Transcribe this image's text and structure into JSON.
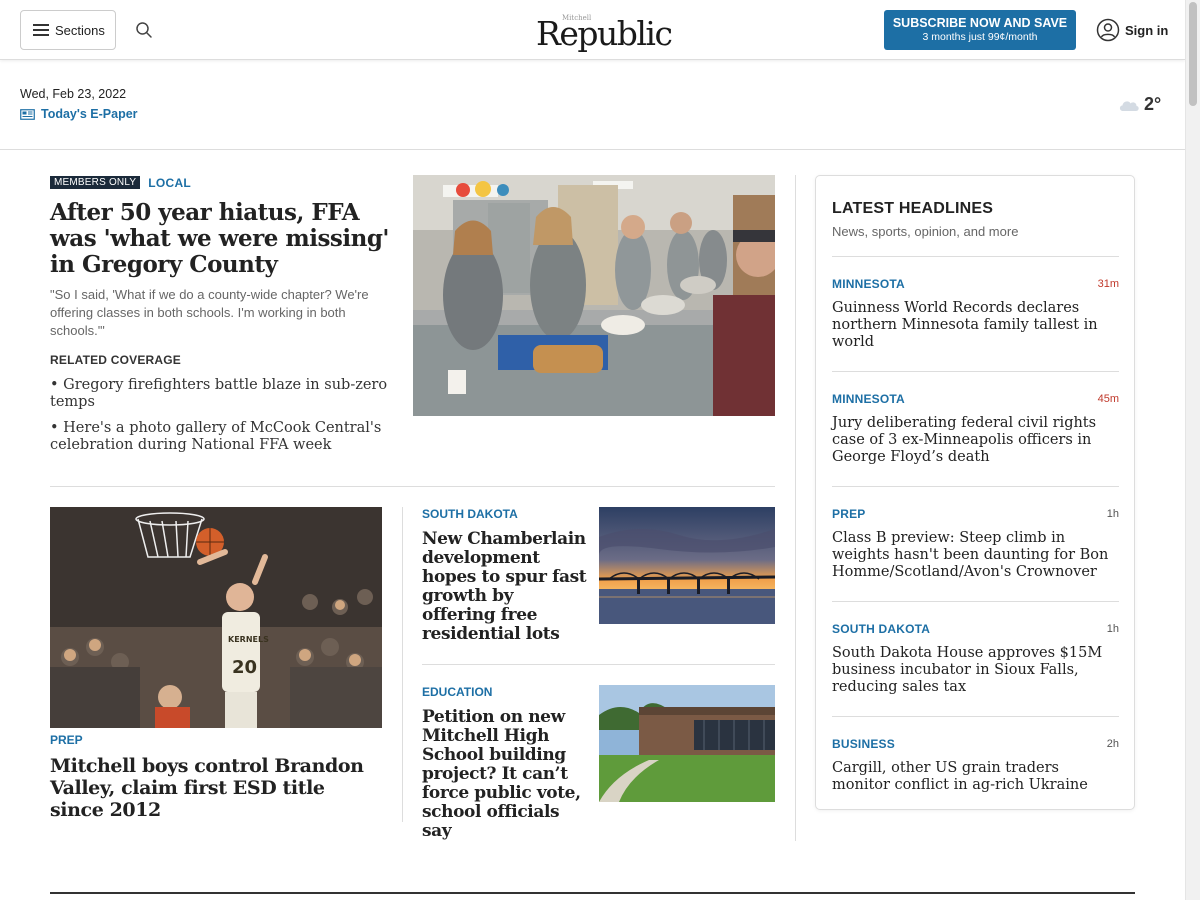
{
  "header": {
    "sections_label": "Sections",
    "logo_small": "Mitchell",
    "logo_main": "Republic",
    "subscribe_main": "SUBSCRIBE NOW AND SAVE",
    "subscribe_sub": "3 months just 99¢/month",
    "signin_label": "Sign in"
  },
  "datebar": {
    "date": "Wed, Feb 23, 2022",
    "epaper_label": "Today's E-Paper",
    "temperature": "2°"
  },
  "lead": {
    "badge": "MEMBERS ONLY",
    "kicker": "LOCAL",
    "title": "After 50 year hiatus, FFA was 'what we were missing' in Gregory County",
    "summary": "\"So I said, 'What if we do a county-wide chapter? We're offering classes in both schools. I'm working in both schools.'\"",
    "related_label": "RELATED COVERAGE",
    "related": [
      "• Gregory firefighters battle blaze in sub-zero temps",
      "• Here's a photo gallery of McCook Central's celebration during National FFA week"
    ]
  },
  "stories": {
    "basketball": {
      "kicker": "PREP",
      "title": "Mitchell boys control Brandon Valley, claim first ESD title since 2012",
      "jersey_text": "KERNELS",
      "jersey_number": "20"
    },
    "chamberlain": {
      "kicker": "SOUTH DAKOTA",
      "title": "New Chamberlain development hopes to spur fast growth by offering free residential lots"
    },
    "mitchell_school": {
      "kicker": "EDUCATION",
      "title": "Petition on new Mitchell High School building project? It can’t force public vote, school officials say"
    }
  },
  "latest": {
    "title": "LATEST HEADLINES",
    "subtitle": "News, sports, opinion, and more",
    "items": [
      {
        "kicker": "MINNESOTA",
        "time": "31m",
        "title": "Guinness World Records declares northern Minnesota family tallest in world"
      },
      {
        "kicker": "MINNESOTA",
        "time": "45m",
        "title": "Jury deliberating federal civil rights case of 3 ex-Minneapolis officers in George Floyd’s death"
      },
      {
        "kicker": "PREP",
        "time": "1h",
        "title": "Class B preview: Steep climb in weights hasn't been daunting for Bon Homme/Scotland/Avon's Crownover"
      },
      {
        "kicker": "SOUTH DAKOTA",
        "time": "1h",
        "title": "South Dakota House approves $15M business incubator in Sioux Falls, reducing sales tax"
      },
      {
        "kicker": "BUSINESS",
        "time": "2h",
        "title": "Cargill, other US grain traders monitor conflict in ag-rich Ukraine"
      }
    ]
  },
  "colors": {
    "accent": "#1d6fa5",
    "badge_bg": "#1b2a3a",
    "recent_time": "#c0392b"
  }
}
